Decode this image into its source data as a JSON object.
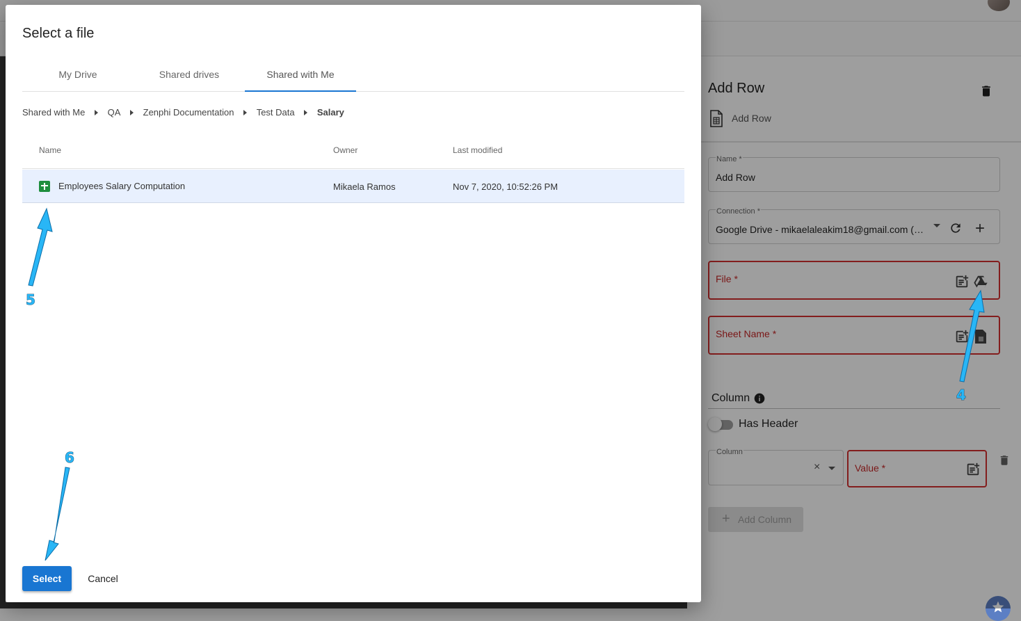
{
  "dialog": {
    "title": "Select a file",
    "tabs": [
      {
        "label": "My Drive",
        "active": false
      },
      {
        "label": "Shared drives",
        "active": false
      },
      {
        "label": "Shared with Me",
        "active": true
      }
    ],
    "breadcrumb": [
      "Shared with Me",
      "QA",
      "Zenphi Documentation",
      "Test Data",
      "Salary"
    ],
    "table": {
      "headers": [
        "Name",
        "Owner",
        "Last modified"
      ],
      "rows": [
        {
          "name": "Employees Salary Computation",
          "owner": "Mikaela Ramos",
          "modified": "Nov 7, 2020, 10:52:26 PM",
          "icon": "google-sheets-icon",
          "selected": true
        }
      ]
    },
    "select_label": "Select",
    "cancel_label": "Cancel"
  },
  "panel": {
    "title": "Add Row",
    "subtitle": "Add Row",
    "name_field": {
      "label": "Name *",
      "value": "Add Row"
    },
    "connection_field": {
      "label": "Connection *",
      "value": "Google Drive - mikaelaleakim18@gmail.com (mi..."
    },
    "file_field": {
      "label": "File *"
    },
    "sheet_field": {
      "label": "Sheet Name *"
    },
    "column_section": {
      "title": "Column",
      "has_header_label": "Has Header",
      "has_header_on": false
    },
    "column_select": {
      "label": "Column",
      "value": ""
    },
    "value_field": {
      "label": "Value *"
    },
    "add_column_label": "Add Column"
  },
  "annotations": [
    {
      "number": "4"
    },
    {
      "number": "5"
    },
    {
      "number": "6"
    }
  ],
  "colors": {
    "accent": "#1976d2",
    "error": "#d32f2f",
    "annotation": "#29b6f6",
    "sheets_green": "#1e8e3e",
    "selected_row": "#e8f0fe"
  }
}
